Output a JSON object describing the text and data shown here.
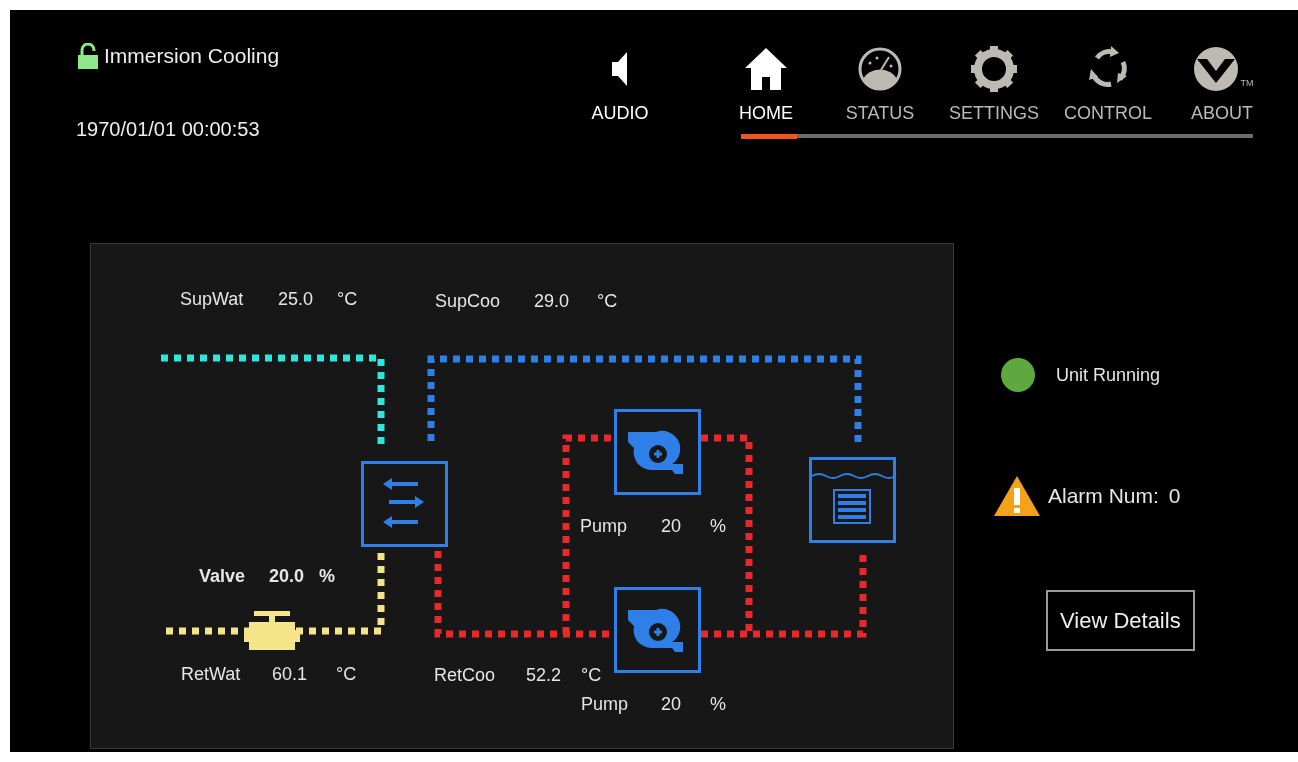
{
  "header": {
    "title": "Immersion Cooling",
    "locked": false,
    "datetime": "1970/01/01 00:00:53"
  },
  "audio": {
    "label": "AUDIO"
  },
  "tabs": [
    {
      "kind": "home",
      "label": "HOME",
      "selected": true
    },
    {
      "kind": "status",
      "label": "STATUS",
      "selected": false
    },
    {
      "kind": "settings",
      "label": "SETTINGS",
      "selected": false
    },
    {
      "kind": "control",
      "label": "CONTROL",
      "selected": false
    },
    {
      "kind": "about",
      "label": "ABOUT",
      "selected": false,
      "badge": "TM"
    }
  ],
  "diagram": {
    "readings": [
      {
        "kind": "supply_water",
        "label": "SupWat",
        "value": "25.0",
        "unit": "°C"
      },
      {
        "kind": "supply_coolant",
        "label": "SupCoo",
        "value": "29.0",
        "unit": "°C"
      },
      {
        "kind": "valve",
        "label": "Valve",
        "value": "20.0",
        "unit": "%"
      },
      {
        "kind": "return_water",
        "label": "RetWat",
        "value": "60.1",
        "unit": "°C"
      },
      {
        "kind": "return_coolant",
        "label": "RetCoo",
        "value": "52.2",
        "unit": "°C"
      }
    ],
    "pumps": [
      {
        "label": "Pump",
        "value": "20",
        "unit": "%"
      },
      {
        "label": "Pump",
        "value": "20",
        "unit": "%"
      }
    ]
  },
  "status": {
    "label": "Unit Running",
    "color": "#5fa83f"
  },
  "alarm": {
    "label": "Alarm Num:",
    "count": "0"
  },
  "details_button": {
    "label": "View Details"
  }
}
